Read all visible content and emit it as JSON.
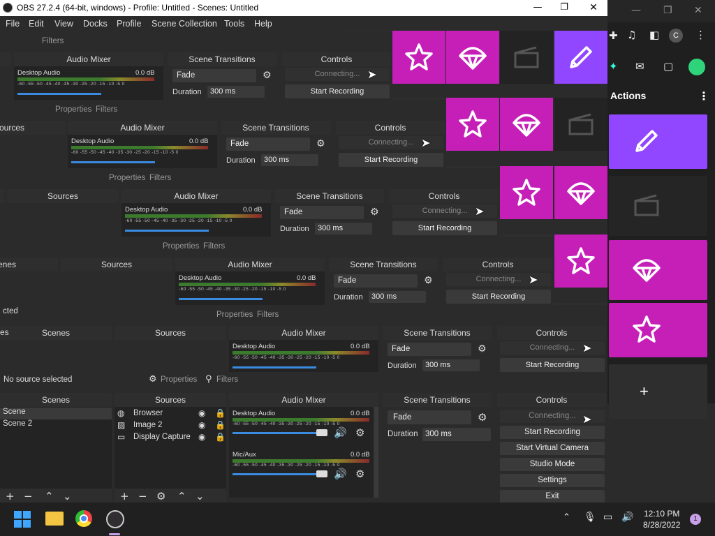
{
  "window": {
    "title": "OBS 27.2.4 (64-bit, windows) - Profile: Untitled - Scenes: Untitled",
    "minimize": "—",
    "maximize": "❐",
    "close": "✕"
  },
  "menu": [
    "File",
    "Edit",
    "View",
    "Docks",
    "Profile",
    "Scene Collection",
    "Tools",
    "Help"
  ],
  "docks": {
    "scenes": "Scenes",
    "sources": "Sources",
    "audio_mixer": "Audio Mixer",
    "scene_transitions": "Scene Transitions",
    "controls": "Controls",
    "properties": "Properties",
    "filters": "Filters",
    "no_source": "No source selected",
    "cut_label": "cted",
    "es_label": "es"
  },
  "scenes": [
    "Scene",
    "Scene 2"
  ],
  "sources": [
    "Browser",
    "Image 2",
    "Display Capture"
  ],
  "audio": {
    "desktop": "Desktop Audio",
    "mic": "Mic/Aux",
    "db": "0.0 dB",
    "scale": "-60 -55 -50 -45 -40 -35 -30 -25 -20 -15 -10 -5 0"
  },
  "transition": {
    "selected": "Fade",
    "duration_label": "Duration",
    "duration_value": "300 ms"
  },
  "controls": {
    "connecting": "Connecting...",
    "start_recording": "Start Recording",
    "start_virtual_camera": "Start Virtual Camera",
    "studio_mode": "Studio Mode",
    "settings": "Settings",
    "exit": "Exit"
  },
  "chrome": {
    "avatar_letter": "C",
    "actions_title": "Actions",
    "dots": "⋮"
  },
  "stream_deck": {
    "plus": "+",
    "colors": {
      "pink": "#c51fb8",
      "purple": "#9146ff",
      "dark": "#232323"
    },
    "icons": [
      "star-icon",
      "parachute-icon",
      "clapperboard-icon",
      "pencil-icon"
    ]
  },
  "taskbar": {
    "time": "12:10 PM",
    "date": "8/28/2022",
    "notification_count": "1"
  }
}
